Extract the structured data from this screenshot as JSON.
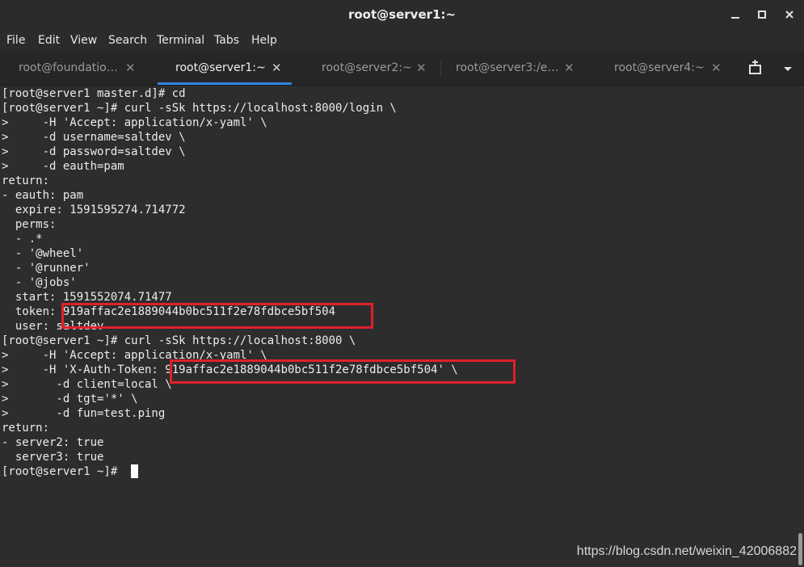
{
  "window": {
    "title": "root@server1:~"
  },
  "menu": [
    "File",
    "Edit",
    "View",
    "Search",
    "Terminal",
    "Tabs",
    "Help"
  ],
  "tabs": [
    {
      "label": "root@foundatio…"
    },
    {
      "label": "root@server1:~"
    },
    {
      "label": "root@server2:~"
    },
    {
      "label": "root@server3:/e…"
    },
    {
      "label": "root@server4:~"
    }
  ],
  "active_tab": "root@server1:~",
  "terminal": {
    "lines": [
      "[root@server1 master.d]# cd",
      "[root@server1 ~]# curl -sSk https://localhost:8000/login \\",
      ">     -H 'Accept: application/x-yaml' \\",
      ">     -d username=saltdev \\",
      ">     -d password=saltdev \\",
      ">     -d eauth=pam",
      "return:",
      "- eauth: pam",
      "  expire: 1591595274.714772",
      "  perms:",
      "  - .*",
      "  - '@wheel'",
      "  - '@runner'",
      "  - '@jobs'",
      "  start: 1591552074.71477",
      "  token: 919affac2e1889044b0bc511f2e78fdbce5bf504",
      "  user: saltdev",
      "[root@server1 ~]# curl -sSk https://localhost:8000 \\",
      ">     -H 'Accept: application/x-yaml' \\",
      ">     -H 'X-Auth-Token: 919affac2e1889044b0bc511f2e78fdbce5bf504' \\",
      ">       -d client=local \\",
      ">       -d tgt='*' \\",
      ">       -d fun=test.ping",
      "return:",
      "- server2: true",
      "  server3: true",
      "[root@server1 ~]# "
    ]
  },
  "watermark": "https://blog.csdn.net/weixin_42006882",
  "colors": {
    "highlight": "#e0202a",
    "accent": "#3584e4",
    "background": "#2d2d2d"
  }
}
